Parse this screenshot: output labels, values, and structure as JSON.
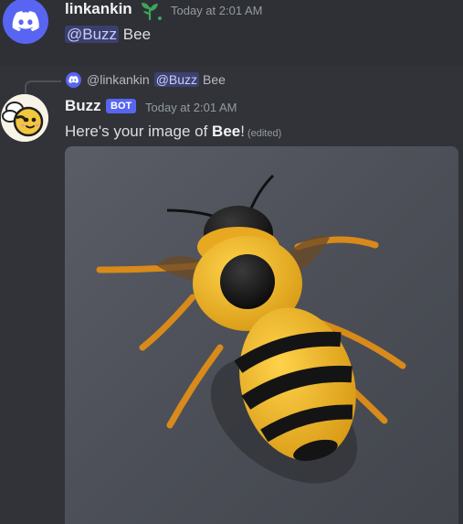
{
  "message1": {
    "avatar_icon": "discord-logo-icon",
    "username": "linkankin",
    "badge_icon": "sprout-icon",
    "timestamp": "Today at 2:01 AM",
    "mention": "@Buzz",
    "text": " Bee"
  },
  "message2": {
    "reply": {
      "avatar_icon": "discord-logo-icon",
      "user": "@linkankin",
      "mention": "@Buzz",
      "text": "Bee"
    },
    "avatar_icon": "bee-avatar-icon",
    "username": "Buzz",
    "badge": "BOT",
    "timestamp": "Today at 2:01 AM",
    "text_before": "Here's your image of ",
    "text_bold": "Bee",
    "text_after": "!",
    "edited": "(edited)",
    "attachment": {
      "kind": "image",
      "subject": "bee"
    }
  },
  "colors": {
    "background": "#313338",
    "hover_background": "#2e3035",
    "blurple": "#5865f2",
    "mention_text": "#c9cdfb",
    "timestamp": "#949ba4"
  }
}
